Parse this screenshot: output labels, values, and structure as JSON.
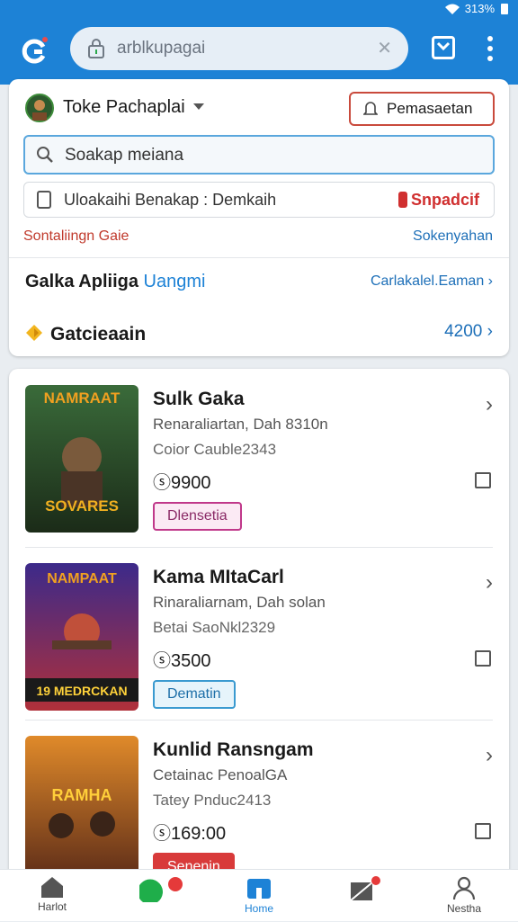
{
  "status": {
    "battery_text": "313%"
  },
  "browser": {
    "url": "arblkupagai"
  },
  "account": {
    "name": "Toke Pachaplai",
    "register_label": "Pemasaetan"
  },
  "search": {
    "placeholder": "Soakap meiana"
  },
  "promo": {
    "text": "Uloakaihi Benakap : Demkaih",
    "tag": "Snpadcif"
  },
  "links": {
    "left": "Sontaliingn Gaie",
    "right": "Sokenyahan"
  },
  "section": {
    "title": "Galka Apliiga",
    "title_accent": "Uangmi",
    "link": "Carlakalel.Eaman"
  },
  "category": {
    "label": "Gatcieaain",
    "value": "4200"
  },
  "items": [
    {
      "name": "Sulk Gaka",
      "line1": "Renaraliartan, Dah 8310n",
      "line2": "Coior Cauble2343",
      "price": "9900",
      "badge": "Dlensetia",
      "cover_title": "NAMRAAT",
      "cover_sub": "SOVARES"
    },
    {
      "name": "Kama MItaCarl",
      "line1": "Rinaraliarnam, Dah solan",
      "line2": "Betai SaoNkl2329",
      "price": "3500",
      "badge": "Dematin",
      "cover_title": "NAMPAAT",
      "cover_sub": "19 MEDRCKAN"
    },
    {
      "name": "Kunlid Ransngam",
      "line1": "Cetainac PenoalGA",
      "line2": "Tatey Pnduc2413",
      "price": "169:00",
      "badge": "Senenin",
      "cover_title": "RAMHA"
    }
  ],
  "nav": {
    "home_left": "Harlot",
    "home": "Home",
    "profile": "Nestha"
  },
  "colors": {
    "primary": "#1d82d6",
    "danger": "#c94a3c"
  }
}
